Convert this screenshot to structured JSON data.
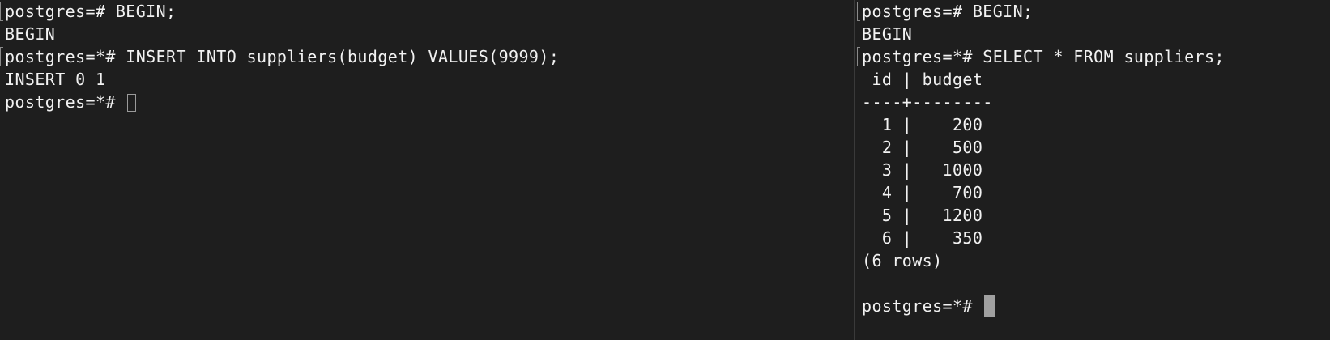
{
  "left_terminal": {
    "lines": [
      {
        "text": "postgres=# BEGIN;",
        "marked": true
      },
      {
        "text": "BEGIN",
        "marked": false
      },
      {
        "text": "postgres=*# INSERT INTO suppliers(budget) VALUES(9999);",
        "marked": true
      },
      {
        "text": "INSERT 0 1",
        "marked": false
      }
    ],
    "prompt": "postgres=*# "
  },
  "right_terminal": {
    "lines": [
      {
        "text": "postgres=# BEGIN;",
        "marked": true
      },
      {
        "text": "BEGIN",
        "marked": false
      },
      {
        "text": "postgres=*# SELECT * FROM suppliers;",
        "marked": true
      }
    ],
    "table": {
      "header": " id | budget",
      "separator": "----+--------",
      "rows": [
        "  1 |    200",
        "  2 |    500",
        "  3 |   1000",
        "  4 |    700",
        "  5 |   1200",
        "  6 |    350"
      ],
      "footer": "(6 rows)"
    },
    "prompt": "postgres=*# "
  }
}
